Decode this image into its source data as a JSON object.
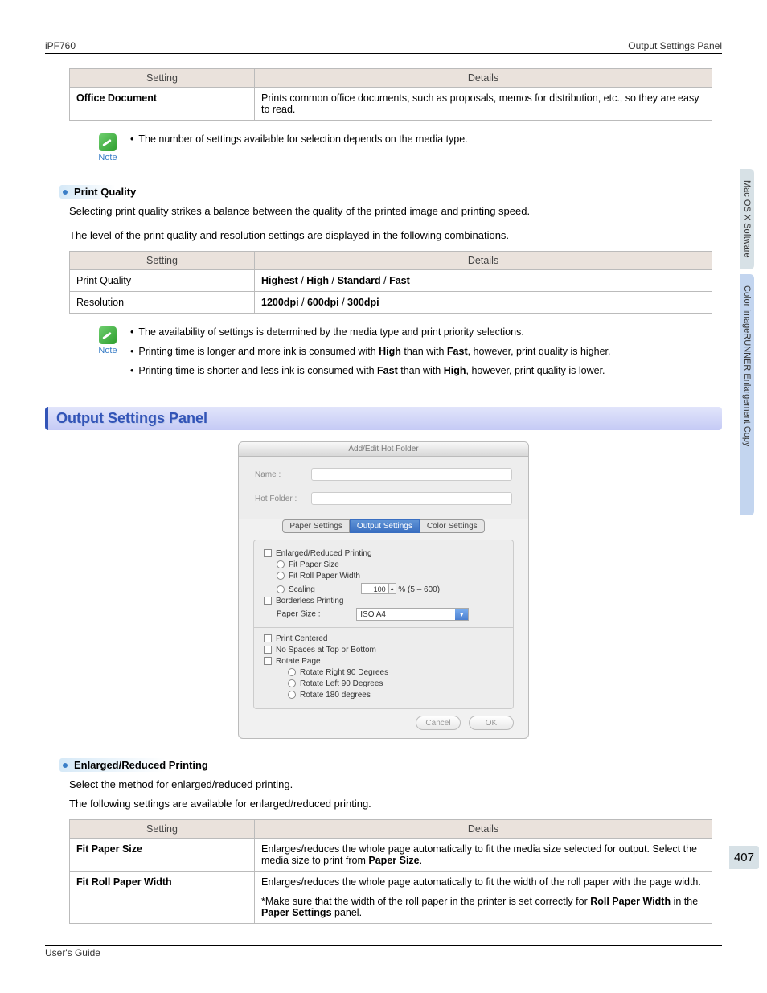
{
  "header": {
    "left": "iPF760",
    "right": "Output Settings Panel"
  },
  "table1": {
    "h1": "Setting",
    "h2": "Details",
    "r1c1": "Office Document",
    "r1c2": "Prints common office documents, such as proposals, memos for distribution, etc., so they are easy to read."
  },
  "note1": {
    "label": "Note",
    "line1": "The number of settings available for selection depends on the media type."
  },
  "sec1": {
    "title": "Print Quality",
    "p1": "Selecting print quality strikes a balance between the quality of the printed image and printing speed.",
    "p2": "The level of the print quality and resolution settings are displayed in the following combinations."
  },
  "table2": {
    "h1": "Setting",
    "h2": "Details",
    "r1c1": "Print Quality",
    "r1c2_b1": "Highest",
    "r1c2_s1": " / ",
    "r1c2_b2": "High",
    "r1c2_s2": " / ",
    "r1c2_b3": "Standard",
    "r1c2_s3": " / ",
    "r1c2_b4": "Fast",
    "r2c1": "Resolution",
    "r2c2_b1": "1200dpi",
    "r2c2_s1": " / ",
    "r2c2_b2": "600dpi",
    "r2c2_s2": " / ",
    "r2c2_b3": "300dpi"
  },
  "note2": {
    "label": "Note",
    "l1": "The availability of settings is determined by the media type and print priority selections.",
    "l2_a": "Printing time is longer and more ink is consumed with ",
    "l2_b1": "High",
    "l2_b": " than with ",
    "l2_b2": "Fast",
    "l2_c": ", however, print quality is higher.",
    "l3_a": "Printing time is shorter and less ink is consumed with ",
    "l3_b1": "Fast",
    "l3_b": " than with ",
    "l3_b2": "High",
    "l3_c": ", however, print quality is lower."
  },
  "panel_title": "Output Settings Panel",
  "dialog": {
    "title": "Add/Edit Hot Folder",
    "name_lbl": "Name :",
    "hotfolder_lbl": "Hot Folder :",
    "tab1": "Paper Settings",
    "tab2": "Output Settings",
    "tab3": "Color Settings",
    "chk_enlarged": "Enlarged/Reduced Printing",
    "rad_fit_paper": "Fit Paper Size",
    "rad_fit_roll": "Fit Roll Paper Width",
    "rad_scaling": "Scaling",
    "scaling_val": "100",
    "scaling_suffix": " % (5 – 600)",
    "chk_borderless": "Borderless Printing",
    "paper_size_lbl": "Paper Size :",
    "paper_size_val": "ISO A4",
    "chk_centered": "Print Centered",
    "chk_nospaces": "No Spaces at Top or Bottom",
    "chk_rotate": "Rotate Page",
    "rad_r90": "Rotate Right 90 Degrees",
    "rad_l90": "Rotate Left 90 Degrees",
    "rad_180": "Rotate 180 degrees",
    "btn_cancel": "Cancel",
    "btn_ok": "OK"
  },
  "sec2": {
    "title": "Enlarged/Reduced Printing",
    "p1": "Select the method for enlarged/reduced printing.",
    "p2": "The following settings are available for enlarged/reduced printing."
  },
  "table3": {
    "h1": "Setting",
    "h2": "Details",
    "r1c1": "Fit Paper Size",
    "r1c2_a": "Enlarges/reduces the whole page automatically to fit the media size selected for output. Select the media size to print from ",
    "r1c2_b": "Paper Size",
    "r1c2_c": ".",
    "r2c1": "Fit Roll Paper Width",
    "r2c2_a": "Enlarges/reduces the whole page automatically to fit the width of the roll paper with the page width.",
    "r2c2_b": "*Make sure that the width of the roll paper in the printer is set correctly for ",
    "r2c2_c": "Roll Paper Width",
    "r2c2_d": " in the ",
    "r2c2_e": "Paper Settings",
    "r2c2_f": " panel."
  },
  "side": {
    "t1": "Mac OS X Software",
    "t2": "Color imageRUNNER Enlargement Copy"
  },
  "page_num": "407",
  "footer": {
    "left": "User's Guide",
    "right": ""
  }
}
